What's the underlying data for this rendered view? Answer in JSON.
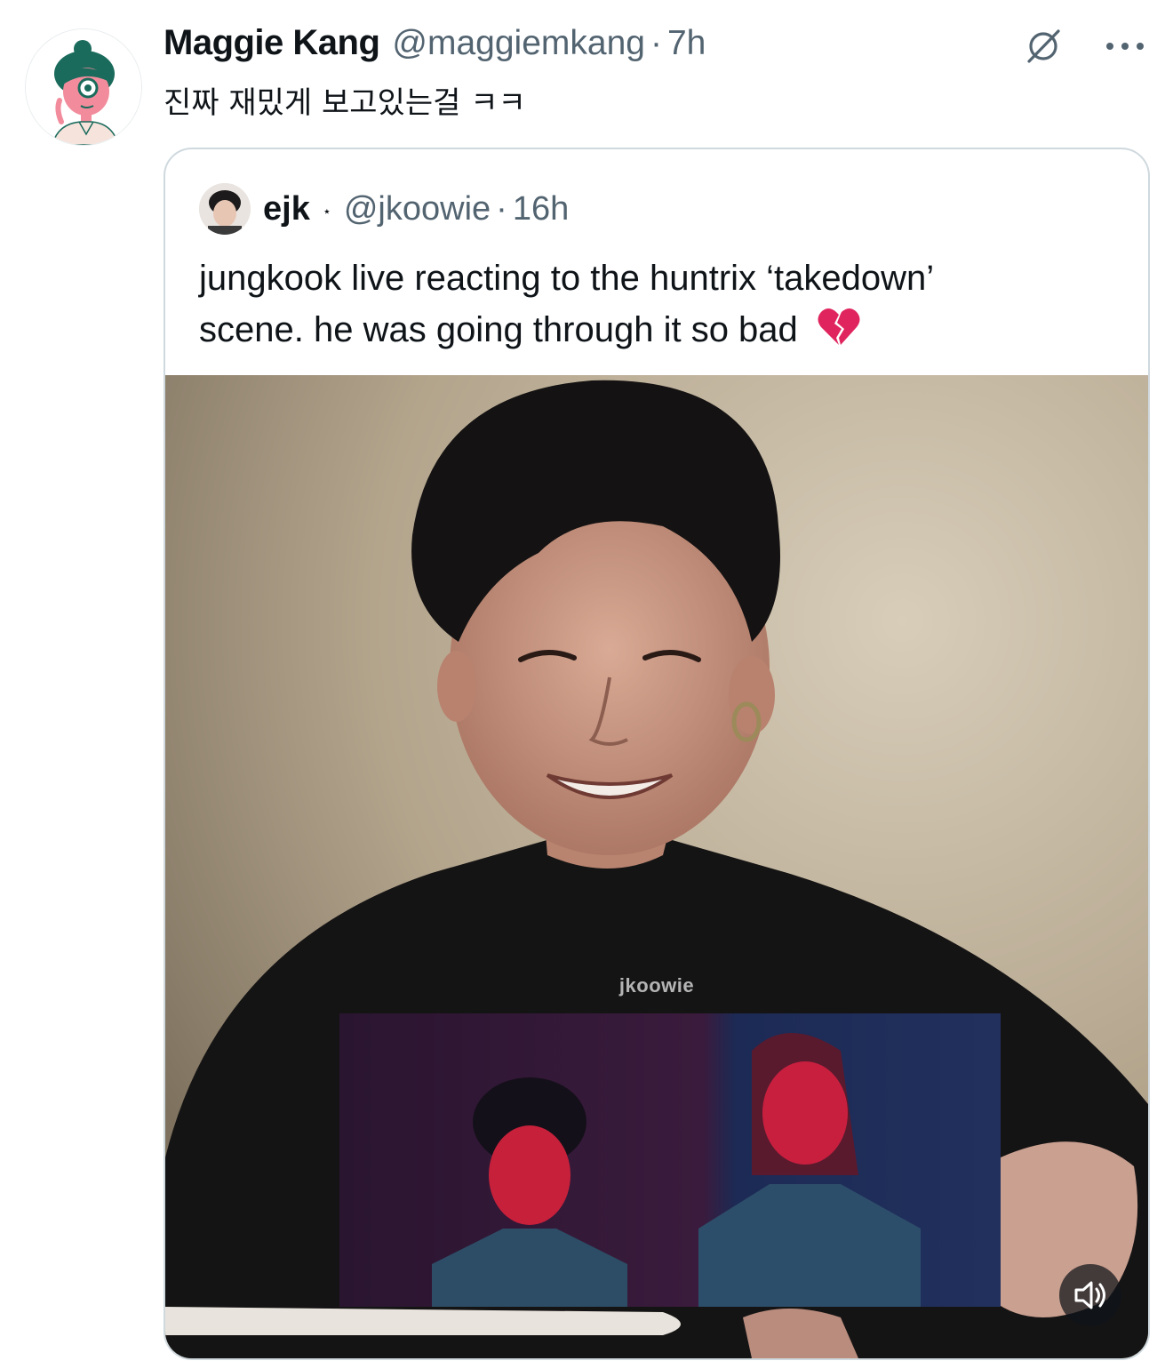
{
  "tweet": {
    "author_name": "Maggie Kang",
    "author_handle": "@maggiemkang",
    "separator": "·",
    "timestamp": "7h",
    "text": "진짜 재밌게 보고있는걸 ㅋㅋ",
    "icons": [
      "grok-icon",
      "more-icon"
    ]
  },
  "quoted_tweet": {
    "author_name": "ejk",
    "verified_mark": "⋆",
    "author_handle": "@jkoowie",
    "separator": "·",
    "timestamp": "16h",
    "text_line1": "jungkook live reacting to the huntrix ‘takedown’",
    "text_line2": "scene. he was going through it so bad",
    "emoji": "broken-heart-emoji",
    "media": {
      "type": "video",
      "watermark": "jkoowie",
      "volume_icon": "volume-icon"
    }
  },
  "colors": {
    "text_primary": "#0f1419",
    "text_secondary": "#536471",
    "card_border": "#cfd9de",
    "avatar_accent": "#1a6b5c",
    "avatar_skin": "#f28c9c",
    "broken_heart": "#e0245e"
  }
}
